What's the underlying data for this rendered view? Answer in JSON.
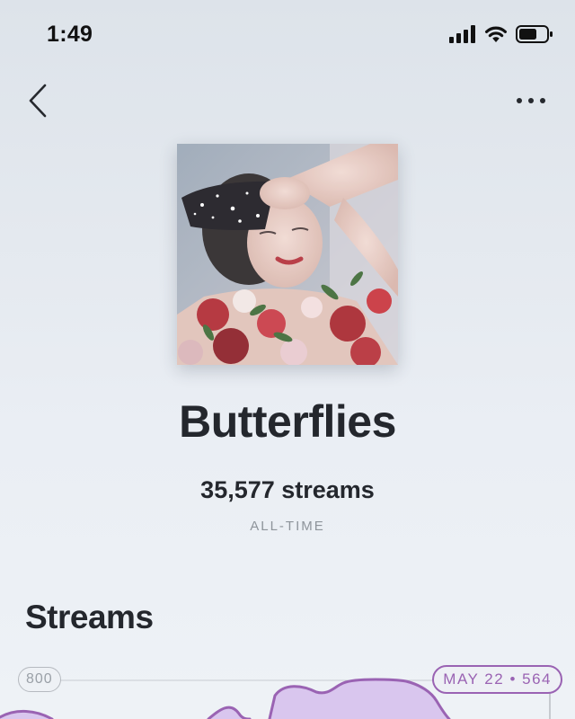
{
  "status_bar": {
    "time": "1:49",
    "icons": [
      "cellular-signal-icon",
      "wifi-icon",
      "battery-icon"
    ]
  },
  "nav": {
    "back_icon": "chevron-left-icon",
    "more_icon": "more-horizontal-icon"
  },
  "song": {
    "title": "Butterflies",
    "streams": "35,577 streams",
    "period": "ALL-TIME"
  },
  "streams_section": {
    "title": "Streams",
    "chart_data": {
      "type": "area",
      "y_max_label": "800",
      "ylim": [
        0,
        800
      ],
      "tooltip": {
        "date": "MAY 22",
        "separator": "•",
        "value": "564"
      },
      "fill_color": "#d9c6ee",
      "line_color": "#9a63b3"
    }
  },
  "colors": {
    "accent": "#9a63b3",
    "text_primary": "#24272d",
    "text_secondary": "#8e949b"
  }
}
